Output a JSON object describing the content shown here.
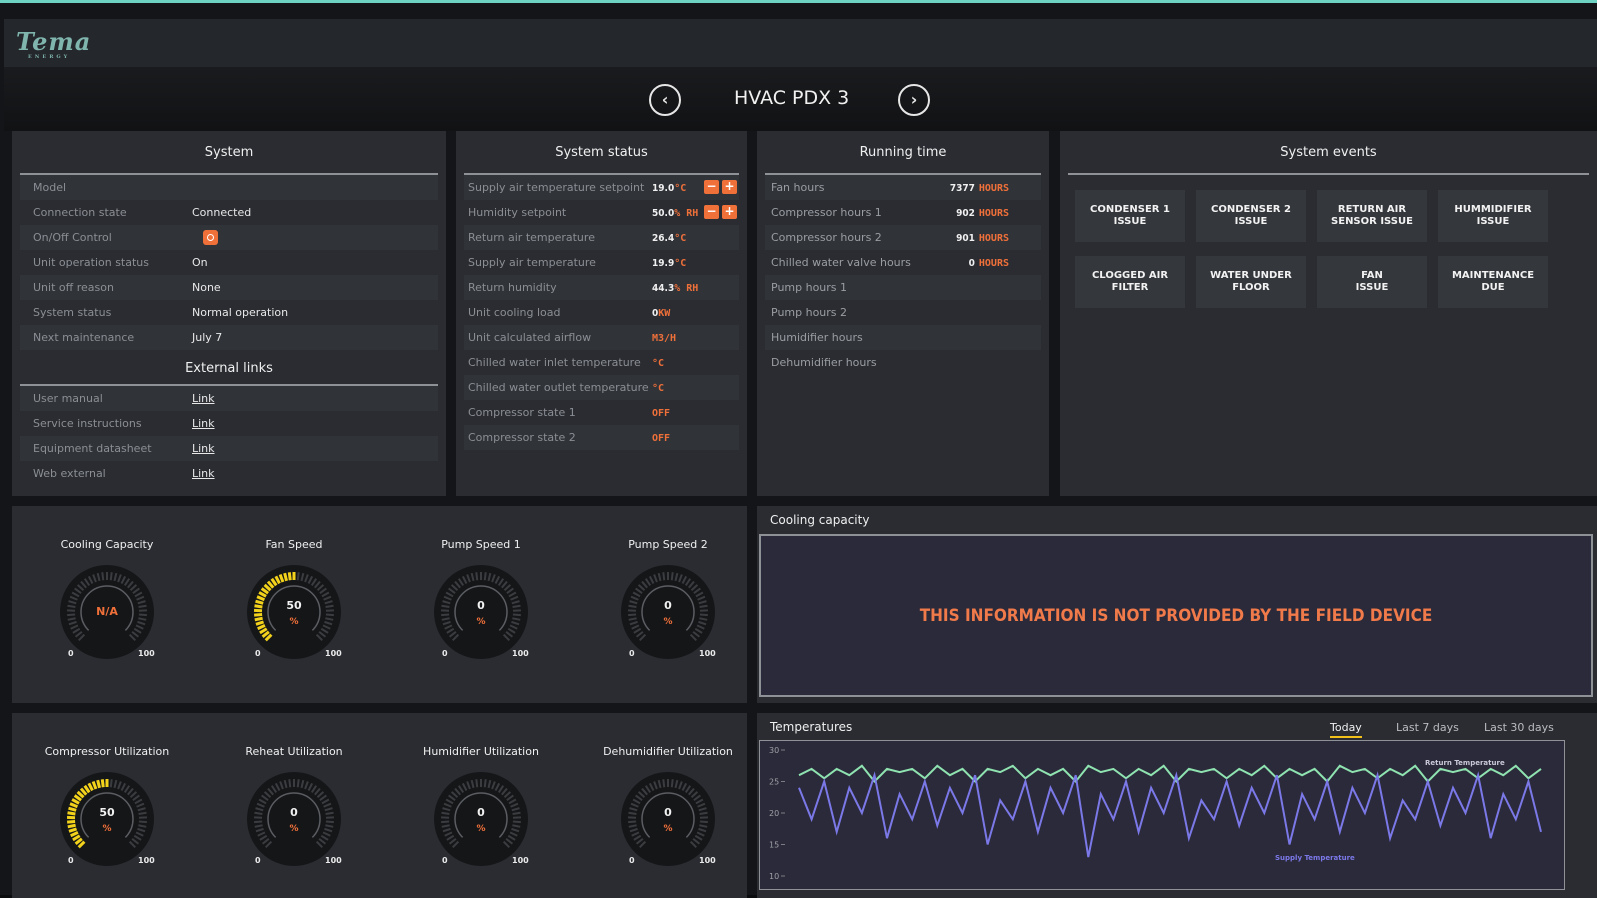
{
  "brand": {
    "logo": "Tema",
    "sub": "ENERGY"
  },
  "header": {
    "title": "HVAC PDX 3"
  },
  "system": {
    "title": "System",
    "rows": [
      {
        "k": "Model",
        "v": ""
      },
      {
        "k": "Connection state",
        "v": "Connected"
      },
      {
        "k": "On/Off Control",
        "v": ""
      },
      {
        "k": "Unit operation status",
        "v": "On"
      },
      {
        "k": "Unit off reason",
        "v": "None"
      },
      {
        "k": "System status",
        "v": "Normal operation"
      },
      {
        "k": "Next maintenance",
        "v": "July 7"
      }
    ],
    "links_title": "External links",
    "links": [
      {
        "k": "User manual",
        "v": "Link"
      },
      {
        "k": "Service instructions",
        "v": "Link"
      },
      {
        "k": "Equipment datasheet",
        "v": "Link"
      },
      {
        "k": "Web external",
        "v": "Link"
      }
    ]
  },
  "status": {
    "title": "System status",
    "rows": [
      {
        "k": "Supply air temperature setpoint",
        "n": "19.0",
        "u": "°C"
      },
      {
        "k": "Humidity setpoint",
        "n": "50.0",
        "u": "% RH"
      },
      {
        "k": "Return air temperature",
        "n": "26.4",
        "u": "°C"
      },
      {
        "k": "Supply air temperature",
        "n": "19.9",
        "u": "°C"
      },
      {
        "k": "Return humidity",
        "n": "44.3",
        "u": "% RH"
      },
      {
        "k": "Unit cooling load",
        "n": "0",
        "u": "KW"
      },
      {
        "k": "Unit calculated airflow",
        "n": "",
        "u": "M3/H"
      },
      {
        "k": "Chilled water inlet temperature",
        "n": "",
        "u": "°C"
      },
      {
        "k": "Chilled water outlet temperature",
        "n": "",
        "u": "°C"
      },
      {
        "k": "Compressor state 1",
        "n": "",
        "u": "OFF"
      },
      {
        "k": "Compressor state 2",
        "n": "",
        "u": "OFF"
      }
    ]
  },
  "running": {
    "title": "Running time",
    "rows": [
      {
        "k": "Fan hours",
        "n": "7377",
        "u": "HOURS"
      },
      {
        "k": "Compressor hours 1",
        "n": "902",
        "u": "HOURS"
      },
      {
        "k": "Compressor hours 2",
        "n": "901",
        "u": "HOURS"
      },
      {
        "k": "Chilled water valve hours",
        "n": "0",
        "u": "HOURS"
      },
      {
        "k": "Pump hours 1",
        "n": "",
        "u": ""
      },
      {
        "k": "Pump hours 2",
        "n": "",
        "u": ""
      },
      {
        "k": "Humidifier hours",
        "n": "",
        "u": ""
      },
      {
        "k": "Dehumidifier hours",
        "n": "",
        "u": ""
      }
    ]
  },
  "events": {
    "title": "System events",
    "items": [
      {
        "l1": "CONDENSER 1",
        "l2": "ISSUE"
      },
      {
        "l1": "CONDENSER 2",
        "l2": "ISSUE"
      },
      {
        "l1": "RETURN AIR",
        "l2": "SENSOR ISSUE"
      },
      {
        "l1": "HUMMIDIFIER",
        "l2": "ISSUE"
      },
      {
        "l1": "CLOGGED AIR",
        "l2": "FILTER"
      },
      {
        "l1": "WATER UNDER",
        "l2": "FLOOR"
      },
      {
        "l1": "FAN",
        "l2": "ISSUE"
      },
      {
        "l1": "MAINTENANCE",
        "l2": "DUE"
      }
    ]
  },
  "gauges": [
    {
      "title": "Cooling Capacity",
      "value": "N/A",
      "unit": "",
      "level": 0,
      "min": "0",
      "max": "100"
    },
    {
      "title": "Fan Speed",
      "value": "50",
      "unit": "%",
      "level": 0.5,
      "min": "0",
      "max": "100"
    },
    {
      "title": "Pump Speed 1",
      "value": "0",
      "unit": "%",
      "level": 0,
      "min": "0",
      "max": "100"
    },
    {
      "title": "Pump Speed 2",
      "value": "0",
      "unit": "%",
      "level": 0,
      "min": "0",
      "max": "100"
    },
    {
      "title": "Compressor Utilization",
      "value": "50",
      "unit": "%",
      "level": 0.5,
      "min": "0",
      "max": "100"
    },
    {
      "title": "Reheat Utilization",
      "value": "0",
      "unit": "%",
      "level": 0,
      "min": "0",
      "max": "100"
    },
    {
      "title": "Humidifier Utilization",
      "value": "0",
      "unit": "%",
      "level": 0,
      "min": "0",
      "max": "100"
    },
    {
      "title": "Dehumidifier Utilization",
      "value": "0",
      "unit": "%",
      "level": 0,
      "min": "0",
      "max": "100"
    }
  ],
  "cooling": {
    "title": "Cooling capacity",
    "message": "THIS INFORMATION IS NOT PROVIDED BY THE FIELD DEVICE"
  },
  "temps": {
    "title": "Temperatures",
    "ranges": [
      "Today",
      "Last 7 days",
      "Last 30 days"
    ],
    "active": 0
  },
  "colors": {
    "accent": "#f0703a",
    "gauge": "#f2d21b",
    "return": "#8fe3b0",
    "supply": "#7b78e8"
  },
  "chart_data": {
    "type": "line",
    "yticks": [
      "30",
      "25",
      "20",
      "15",
      "10"
    ],
    "ylim": [
      10,
      30
    ],
    "series": [
      {
        "name": "Return Temperature",
        "values": [
          26,
          27,
          25.5,
          27,
          26,
          27.5,
          25,
          27,
          26.5,
          27,
          25.5,
          27.5,
          26,
          27,
          25,
          27,
          26.5,
          27.5,
          25.5,
          27,
          26,
          27,
          25,
          27.5,
          26.5,
          27,
          25.5,
          27,
          26,
          27.5,
          25,
          27,
          26.5,
          27,
          25.5,
          27,
          26,
          27.5,
          25.5,
          27,
          26,
          27,
          25,
          27.5,
          26.5,
          27,
          25.5,
          27,
          26,
          27.5,
          25,
          27,
          26.5,
          27,
          25.5,
          27,
          26,
          27.5,
          25.5,
          27
        ]
      },
      {
        "name": "Supply Temperature",
        "values": [
          24,
          19,
          25,
          17,
          24,
          20,
          26,
          16,
          23,
          19,
          25,
          18,
          24,
          20,
          26,
          15,
          22,
          19,
          25,
          17,
          24,
          20,
          26,
          13,
          23,
          19,
          25,
          17,
          24,
          20,
          26,
          16,
          22,
          19,
          25,
          18,
          24,
          20,
          26,
          15,
          23,
          19,
          25,
          17,
          24,
          20,
          26,
          16,
          22,
          19,
          25,
          18,
          24,
          20,
          26,
          16,
          23,
          19,
          25,
          17
        ]
      }
    ]
  }
}
